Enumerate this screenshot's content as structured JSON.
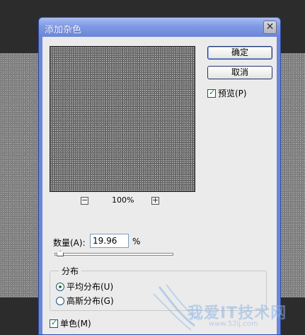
{
  "dialog": {
    "title": "添加杂色",
    "close_symbol": "✕"
  },
  "buttons": {
    "ok": "确定",
    "cancel": "取消"
  },
  "preview_option": {
    "label": "预览(P)",
    "checked": true
  },
  "zoom": {
    "out_symbol": "−",
    "level": "100%",
    "in_symbol": "+"
  },
  "amount": {
    "label": "数量(A):",
    "value": "19.96",
    "unit": "%",
    "slider_fraction": 0.05
  },
  "distribution": {
    "title": "分布",
    "options": [
      {
        "label": "平均分布(U)",
        "selected": true
      },
      {
        "label": "高斯分布(G)",
        "selected": false
      }
    ]
  },
  "monochromatic": {
    "label": "单色(M)",
    "checked": true
  },
  "watermark": {
    "text": "我爱IT技术网",
    "url": "www.52ij.com"
  },
  "colors": {
    "title_bar": "#6c86d8",
    "client_bg": "#ebebeb",
    "check_mark": "#1a8a1a"
  }
}
